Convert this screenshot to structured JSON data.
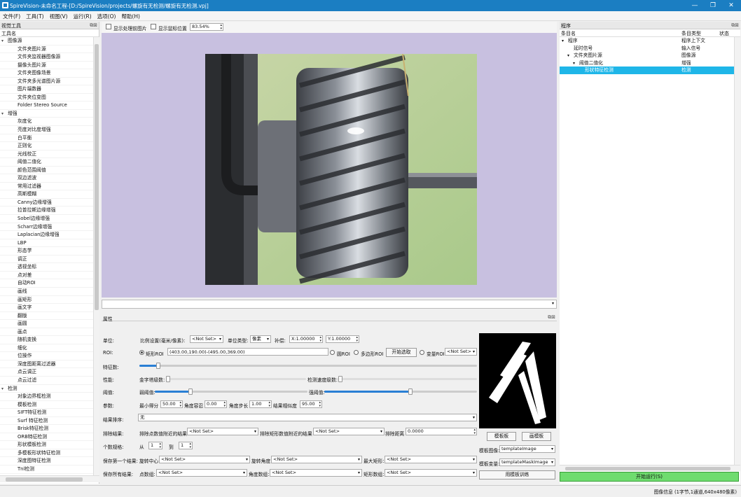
{
  "window": {
    "title": "SpireVision-未命名工程-[D:/SpireVision/projects/螺旋有无检测/螺旋有无检测.vpj]",
    "min": "—",
    "max": "❐",
    "close": "✕"
  },
  "menu": [
    "文件(F)",
    "工具(T)",
    "视图(V)",
    "运行(R)",
    "选项(O)",
    "帮助(H)"
  ],
  "left_panel": {
    "title": "视觉工具",
    "column": "工具名",
    "categories": [
      {
        "name": "图像源",
        "items": [
          "文件夹图片源",
          "文件夹监视器图像源",
          "摄像头图片源",
          "文件夹图像场景",
          "文件夹多光谱图片源",
          "图片端数器",
          "文件夹位变图",
          "Folder Stereo Source"
        ]
      },
      {
        "name": "增强",
        "items": [
          "灰度化",
          "亮度对比度增强",
          "白平衡",
          "正则化",
          "光线校正",
          "阈值二值化",
          "颜色范围阈值",
          "双边滤波",
          "常用过滤器",
          "高斯模糊",
          "Canny边缘增强",
          "拉普拉斯边缘增强",
          "Sobel边缘增强",
          "Scharr边缘增强",
          "Laplacian边缘增强",
          "LBP",
          "形态学",
          "调正",
          "透视坐标",
          "点对差",
          "自动ROI",
          "画线",
          "画矩形",
          "画文字",
          "翻版",
          "画圆",
          "画点",
          "随机变换",
          "细化",
          "位操作",
          "深度图距离过滤器",
          "点云调正",
          "点云过滤"
        ]
      },
      {
        "name": "检测",
        "items": [
          "对象边界框检测",
          "模板检测",
          "SIFT特征检测",
          "Surf 特征检测",
          "Brisk特征检测",
          "ORB特征检测",
          "形状模板检测",
          "多模板形状特征检测",
          "深度图特征检测",
          "Tnl检测"
        ]
      }
    ]
  },
  "toolbar": {
    "show_processed": "显示处理前图片",
    "show_coords": "显示鼠标位置",
    "zoom": "83.54%"
  },
  "props": {
    "title": "属性",
    "unit_label": "单位:",
    "ratio_label": "比例设置(毫米/像素):",
    "ratio_value": "<Not Set>",
    "unit_type_label": "单位类型:",
    "unit_type_value": "像素",
    "comp_label": "补偿:",
    "comp_x": "X:1.00000",
    "comp_y": "Y:1.00000",
    "roi_label": "ROI:",
    "roi_rect": "矩形ROI",
    "roi_value": "(403.00,190.00)-(495.00,369.00)",
    "roi_circle": "圆ROI",
    "roi_poly": "多边形ROI",
    "roi_start": "开始选取",
    "roi_var": "变量ROI",
    "roi_var_value": "<Not Set>",
    "feat_label": "特征数:",
    "perf_label": "性能:",
    "pyr_label": "金字塔级数:",
    "det_label": "检测速度级数:",
    "thr_label": "阈值:",
    "low_label": "弱阈值:",
    "high_label": "强阈值:",
    "param_label": "参数:",
    "min_score_label": "最小得分",
    "min_score": "50.00",
    "angle_tol_label": "角度容忍",
    "angle_tol": "0.00",
    "angle_step_label": "角度步长",
    "angle_step": "1.00",
    "match_label": "结果相似度",
    "match": "95.00",
    "sort_label": "结果排序:",
    "sort_value": "无",
    "exclude_label": "排除结果:",
    "exclude_near_label": "排除点数值附近的结果",
    "exclude_near_value": "<Not Set>",
    "exclude_rect_label": "排除矩形数值附近的结果",
    "exclude_rect_value": "<Not Set>",
    "exclude_dist_label": "排除距离",
    "exclude_dist": "0.0000",
    "count_label": "个数规格:",
    "count_from_label": "从",
    "count_from": "1",
    "count_to_label": "到",
    "count_to": "1",
    "save_first_label": "保存第一个结果:",
    "rot_center_label": "旋转中心:",
    "rot_center": "<Not Set>",
    "rot_angle_label": "旋转角度:",
    "rot_angle": "<Not Set>",
    "bbox_label": "最大矩形:",
    "bbox": "<Not Set>",
    "save_all_label": "保存所有结果:",
    "points_label": "点数组:",
    "points": "<Not Set>",
    "angles_label": "角度数组:",
    "angles": "<Not Set>",
    "rects_label": "矩形数组:",
    "rects": "<Not Set>",
    "tpl_button": "模板板",
    "paint_button": "画模板",
    "tpl_image_label": "模板图像:",
    "tpl_image": "templateImage",
    "tpl_var_label": "模板变量:",
    "tpl_var": "templateMaskImage",
    "apply_button": "用模板训练"
  },
  "right_panel": {
    "title": "程序",
    "col_name": "条目名",
    "col_type": "条目类型",
    "col_state": "状态",
    "rows": [
      {
        "name": "程序",
        "type": "程序上下文",
        "indent": 0,
        "arrow": "▾",
        "selected": false
      },
      {
        "name": "延时信号",
        "type": "输入信号",
        "indent": 1,
        "arrow": "",
        "selected": false
      },
      {
        "name": "文件夹图片源",
        "type": "图像源",
        "indent": 1,
        "arrow": "▾",
        "selected": false
      },
      {
        "name": "阈值二值化",
        "type": "增强",
        "indent": 2,
        "arrow": "▾",
        "selected": false
      },
      {
        "name": "形状特征检测",
        "type": "检测",
        "indent": 3,
        "arrow": "",
        "selected": true
      }
    ],
    "run_button": "开始运行(S)"
  },
  "status": "图像信息 (1字节,1通道,640x480像素)"
}
